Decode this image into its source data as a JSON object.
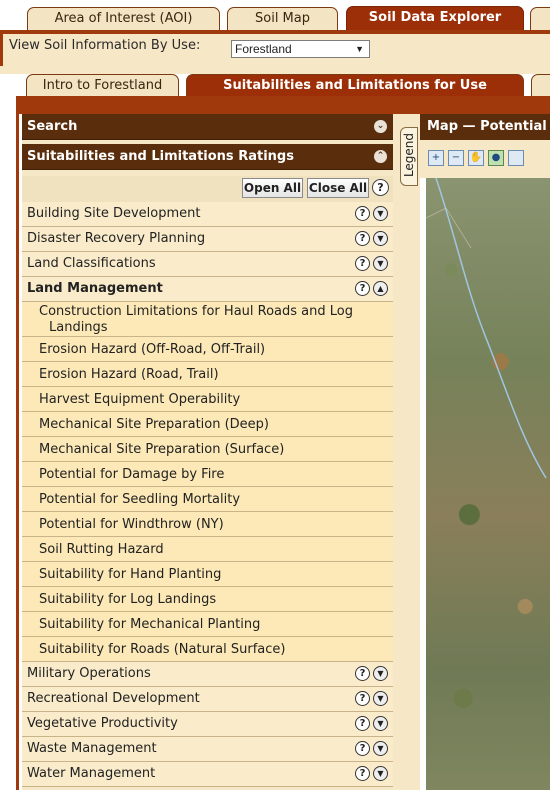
{
  "top_tabs": [
    "Area of Interest (AOI)",
    "Soil Map",
    "Soil Data Explorer"
  ],
  "view": {
    "label": "View Soil Information By Use:",
    "selected": "Forestland",
    "arrow": "▼"
  },
  "sub_tabs": [
    "Intro to Forestland",
    "Suitabilities and Limitations for Use"
  ],
  "search_header": "Search",
  "ratings_header": "Suitabilities and Limitations Ratings",
  "buttons": {
    "open_all": "Open All",
    "close_all": "Close All"
  },
  "help_glyph": "?",
  "collapse_glyph": "⌄",
  "categories_before": [
    "Building Site Development",
    "Disaster Recovery Planning",
    "Land Classifications"
  ],
  "expanded_category": "Land Management",
  "land_management_items": [
    "Construction Limitations for Haul Roads and Log",
    "Landings",
    "Erosion Hazard (Off-Road, Off-Trail)",
    "Erosion Hazard (Road, Trail)",
    "Harvest Equipment Operability",
    "Mechanical Site Preparation (Deep)",
    "Mechanical Site Preparation (Surface)",
    "Potential for Damage by Fire",
    "Potential for Seedling Mortality",
    "Potential for Windthrow (NY)",
    "Soil Rutting Hazard",
    "Suitability for Hand Planting",
    "Suitability for Log Landings",
    "Suitability for Mechanical Planting",
    "Suitability for Roads (Natural Surface)"
  ],
  "categories_after": [
    "Military Operations",
    "Recreational Development",
    "Vegetative Productivity",
    "Waste Management",
    "Water Management"
  ],
  "legend_label": "Legend",
  "map_header": "Map — Potential",
  "map_tools": [
    "zoom-in-icon",
    "zoom-out-icon",
    "pan-hand-icon",
    "globe-icon"
  ]
}
